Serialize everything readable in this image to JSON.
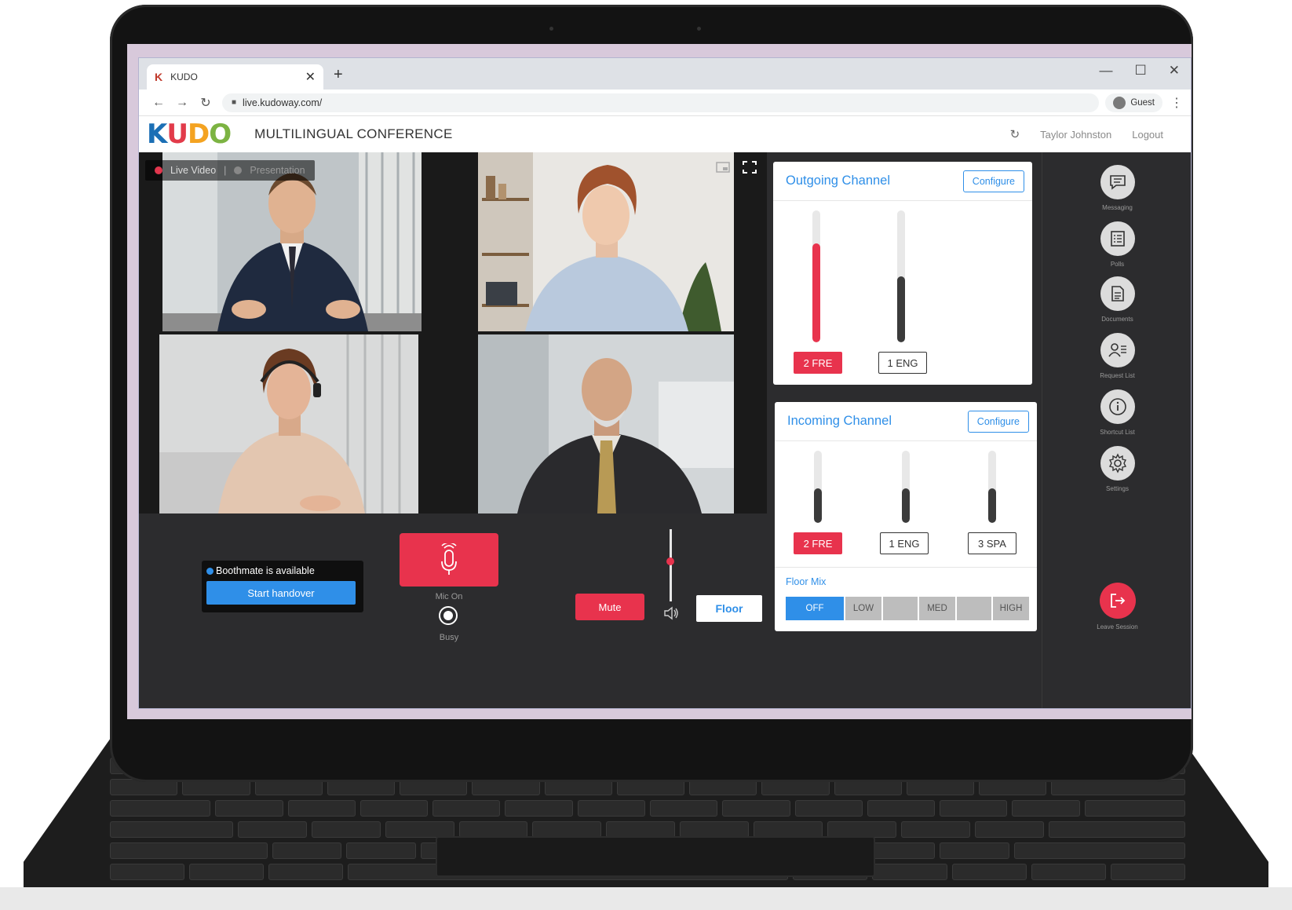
{
  "browser": {
    "tab_title": "KUDO",
    "tab_logo": "K",
    "tab_close": "✕",
    "new_tab": "+",
    "url": "live.kudoway.com/",
    "profile_label": "Guest",
    "window_controls": {
      "minimize": "—",
      "maximize": "☐",
      "close": "✕"
    },
    "nav": {
      "back": "←",
      "forward": "→",
      "reload": "↻",
      "menu": "⋮"
    }
  },
  "app": {
    "logo_letters": [
      "K",
      "U",
      "D",
      "O"
    ],
    "logo_colors": [
      "#1b6fb5",
      "#e23b4a",
      "#f4a321",
      "#7cb342"
    ],
    "title": "MULTILINGUAL CONFERENCE",
    "user_name": "Taylor Johnston",
    "logout_label": "Logout",
    "refresh_icon": "↻"
  },
  "video": {
    "live_video_label": "Live Video",
    "separator": "|",
    "presentation_label": "Presentation",
    "participants": [
      {
        "role": "speaker-man-suit"
      },
      {
        "role": "woman-blouse"
      },
      {
        "role": "woman-headset"
      },
      {
        "role": "older-man-tie"
      }
    ]
  },
  "controls": {
    "boothmate_text": "Boothmate is available",
    "start_handover_label": "Start handover",
    "mic_on_label": "Mic On",
    "busy_label": "Busy",
    "mute_label": "Mute",
    "floor_label": "Floor",
    "volume_level": 0.55
  },
  "outgoing": {
    "title": "Outgoing Channel",
    "configure_label": "Configure",
    "channels": [
      {
        "label": "2 FRE",
        "active": true,
        "level": 0.75
      },
      {
        "label": "1 ENG",
        "active": false,
        "level": 0.5
      }
    ]
  },
  "incoming": {
    "title": "Incoming Channel",
    "configure_label": "Configure",
    "channels": [
      {
        "label": "2 FRE",
        "active": true,
        "level": 0.48
      },
      {
        "label": "1 ENG",
        "active": false,
        "level": 0.48
      },
      {
        "label": "3 SPA",
        "active": false,
        "level": 0.48
      }
    ],
    "floor_mix_label": "Floor Mix",
    "floor_mix_options": [
      "OFF",
      "LOW",
      "",
      "MED",
      "",
      "HIGH"
    ],
    "floor_mix_selected": "OFF"
  },
  "sidebar": {
    "items": [
      {
        "label": "Messaging",
        "icon": "chat-icon",
        "glyph": "☰"
      },
      {
        "label": "Polls",
        "icon": "polls-icon",
        "glyph": "☷"
      },
      {
        "label": "Documents",
        "icon": "document-icon",
        "glyph": "▤"
      },
      {
        "label": "Request List",
        "icon": "request-list-icon",
        "glyph": "👤"
      },
      {
        "label": "Shortcut List",
        "icon": "info-icon",
        "glyph": "ⓘ"
      },
      {
        "label": "Settings",
        "icon": "gear-icon",
        "glyph": "⚙"
      }
    ],
    "leave_label": "Leave Session",
    "leave_glyph": "⇥"
  },
  "colors": {
    "accent_blue": "#2f8fe8",
    "accent_red": "#e8334d",
    "panel_dark": "#2c2c2e"
  }
}
